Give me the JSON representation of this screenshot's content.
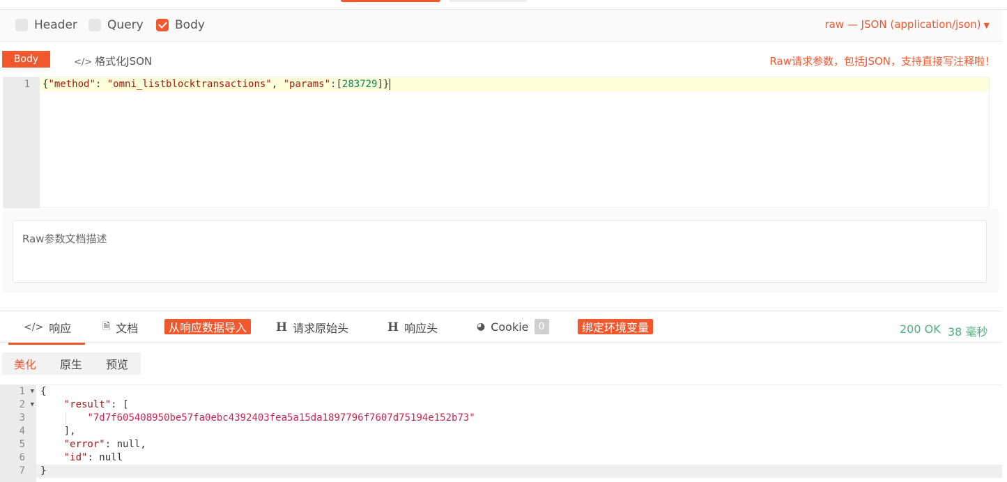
{
  "options": {
    "header_label": "Header",
    "query_label": "Query",
    "body_label": "Body",
    "header_checked": false,
    "query_checked": false,
    "body_checked": true,
    "raw_type": "raw — JSON (application/json)"
  },
  "body_section": {
    "badge": "Body",
    "format_json_label": "格式化JSON",
    "hint": "Raw请求参数，包括JSON，支持直接写注释啦！",
    "editor_line_number": "1",
    "request_body": {
      "open": "{",
      "method_key": "\"method\"",
      "method_value": "\"omni_listblocktransactions\"",
      "params_key": "\"params\"",
      "params_value": "283729",
      "close": "]}"
    },
    "description_placeholder": "Raw参数文档描述"
  },
  "response_tabs": {
    "response": "响应",
    "docs": "文档",
    "import_from_response": "从响应数据导入",
    "request_raw_headers": "请求原始头",
    "response_headers": "响应头",
    "cookie": "Cookie",
    "cookie_count": "0",
    "bind_env_vars": "绑定环境变量",
    "status_code": "200 OK",
    "elapsed": "38 毫秒"
  },
  "view_tabs": {
    "beautify": "美化",
    "raw": "原生",
    "preview": "预览"
  },
  "response_body": {
    "line_numbers": [
      "1",
      "2",
      "3",
      "4",
      "5",
      "6",
      "7"
    ],
    "open": "{",
    "result_key": "\"result\"",
    "result_hash": "\"7d7f605408950be57fa0ebc4392403fea5a15da1897796f7607d75194e152b73\"",
    "error_key": "\"error\"",
    "error_value": "null",
    "id_key": "\"id\"",
    "id_value": "null",
    "close": "}"
  },
  "colors": {
    "accent": "#f2582e",
    "status_green": "#4caf7d"
  }
}
